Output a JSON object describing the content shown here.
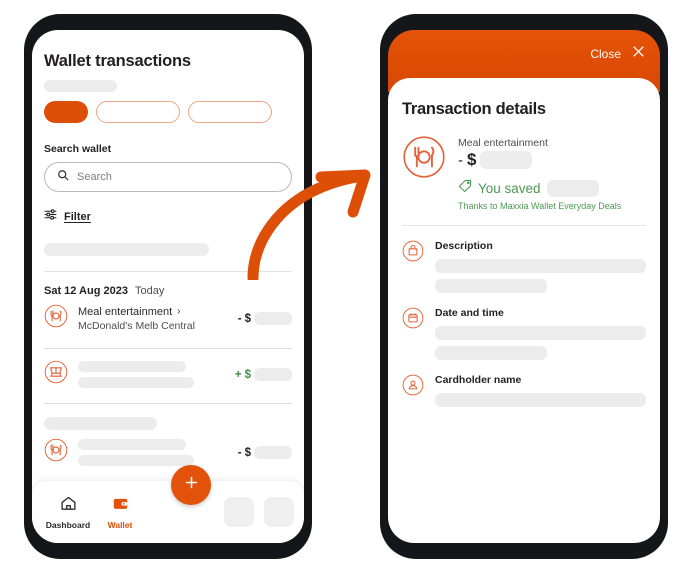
{
  "left_phone": {
    "title": "Wallet transactions",
    "filter_pills": [
      {
        "name": "pill-active",
        "label": "",
        "state": "selected"
      },
      {
        "name": "pill-two",
        "label": "",
        "state": "default"
      },
      {
        "name": "pill-three",
        "label": "",
        "state": "default"
      }
    ],
    "search": {
      "label": "Search wallet",
      "placeholder": "Search",
      "value": "",
      "icon": "search-icon"
    },
    "filter": {
      "label": "Filter",
      "icon": "sliders-icon"
    },
    "date_group": {
      "date": "Sat 12 Aug 2023",
      "relative": "Today"
    },
    "transactions": [
      {
        "icon": "meal-entertainment-icon",
        "title": "Meal entertainment",
        "chevron": "›",
        "merchant": "McDonald's Melb Central",
        "sign": "-",
        "currency": "$",
        "amount": "",
        "direction": "debit"
      },
      {
        "icon": "shopping-cart-icon",
        "title": "",
        "chevron": "",
        "merchant": "",
        "sign": "+",
        "currency": "$",
        "amount": "",
        "direction": "credit"
      },
      {
        "icon": "meal-entertainment-icon",
        "title": "",
        "chevron": "",
        "merchant": "",
        "sign": "-",
        "currency": "$",
        "amount": "",
        "direction": "debit"
      }
    ],
    "bottom_nav": [
      {
        "icon": "home-icon",
        "label": "Dashboard",
        "active": false
      },
      {
        "icon": "wallet-icon",
        "label": "Wallet",
        "active": true
      }
    ],
    "fab": {
      "icon": "plus-icon",
      "label": "+"
    }
  },
  "right_phone": {
    "header": {
      "close_label": "Close",
      "close_icon": "close-x-icon"
    },
    "title": "Transaction details",
    "hero": {
      "icon": "meal-entertainment-icon",
      "category": "Meal entertainment",
      "sign": "-",
      "currency": "$",
      "amount": "",
      "saved_icon": "tag-icon",
      "saved_label": "You saved",
      "saved_amount": "",
      "saved_note": "Thanks to Maxxia Wallet Everyday Deals"
    },
    "detail_rows": [
      {
        "icon": "bag-icon",
        "label": "Description",
        "value_primary": "",
        "value_secondary": ""
      },
      {
        "icon": "calendar-icon",
        "label": "Date and time",
        "value_primary": "",
        "value_secondary": ""
      },
      {
        "icon": "person-icon",
        "label": "Cardholder name",
        "value_primary": "",
        "value_secondary": null
      }
    ]
  },
  "annotation": {
    "arrow": "curved-arrow-icon"
  },
  "colors": {
    "brand_orange": "#dd4f07",
    "header_orange": "#e25309",
    "icon_orange": "#e2643a",
    "green": "#4d9a54",
    "text_dark": "#231f20",
    "skeleton_gray": "#ececec",
    "frame_black": "#15161a"
  }
}
